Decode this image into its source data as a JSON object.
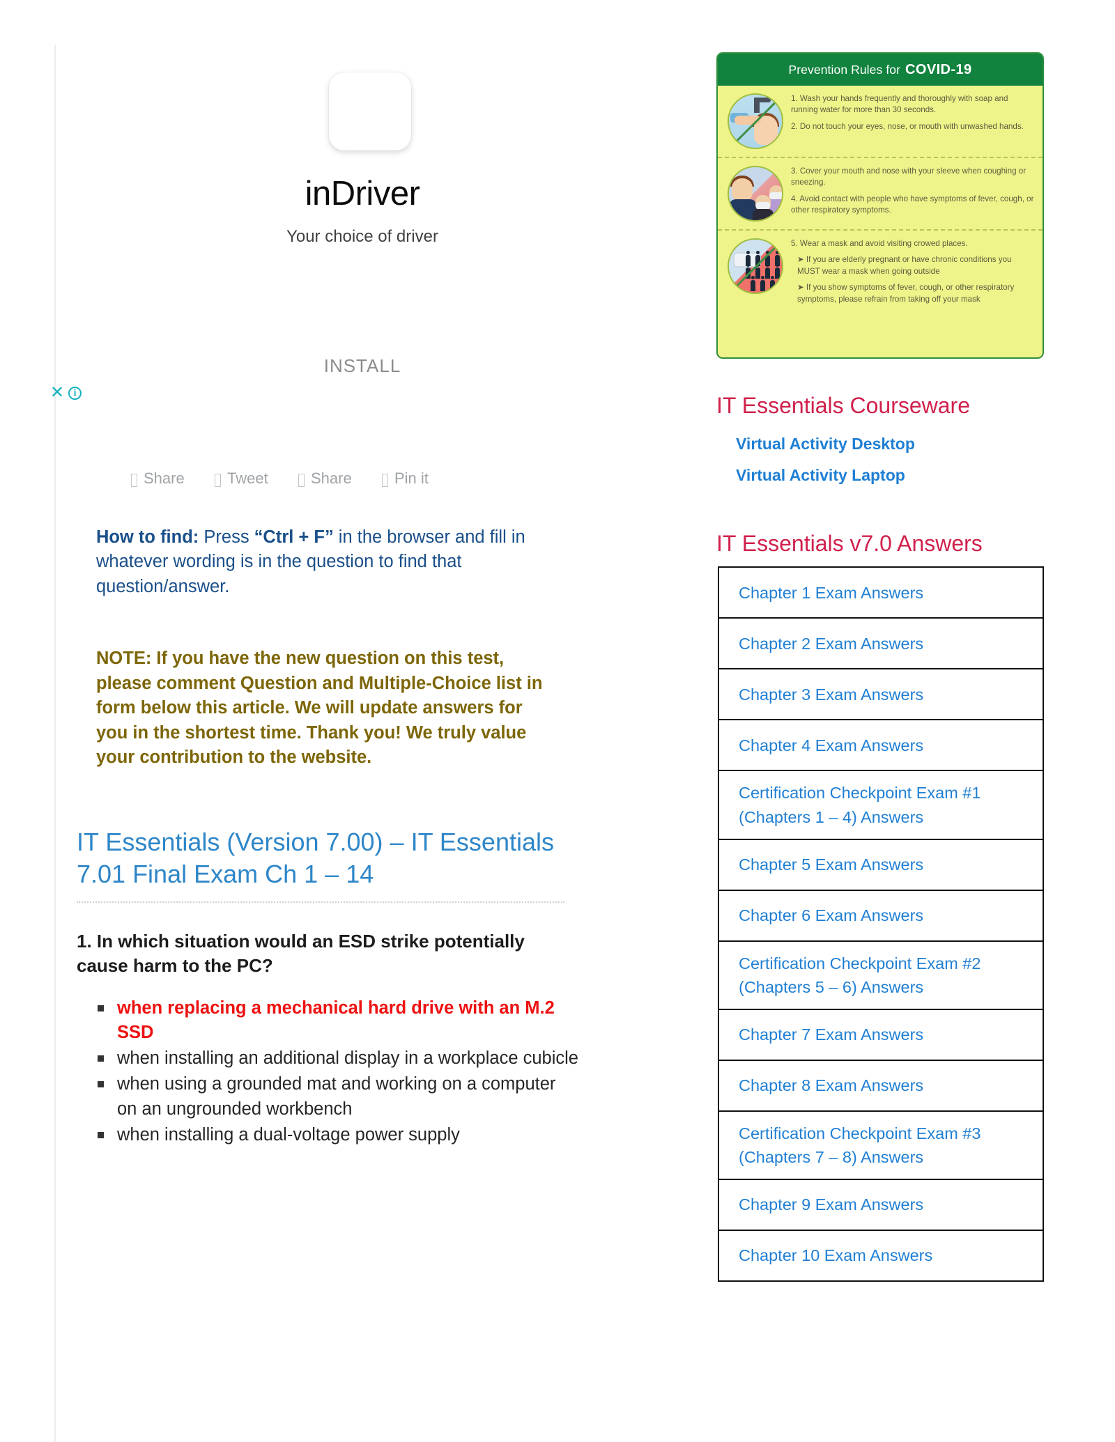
{
  "ad": {
    "app_name": "inDriver",
    "tagline": "Your choice of driver",
    "cta": "INSTALL",
    "close_icon": "✕",
    "info_icon": "i"
  },
  "share_bar": [
    {
      "label": "Share",
      "icon": "facebook-icon"
    },
    {
      "label": "Tweet",
      "icon": "twitter-icon"
    },
    {
      "label": "Share",
      "icon": "linkedin-icon"
    },
    {
      "label": "Pin it",
      "icon": "pinterest-icon"
    }
  ],
  "article": {
    "howto_lead": "How to find:",
    "howto_mid": " Press ",
    "howto_key": "“Ctrl + F”",
    "howto_rest": " in the browser and fill in whatever wording is in the question to find that question/answer.",
    "note": "NOTE: If you have the new question on this test, please comment Question and Multiple-Choice list in form below this article. We will update answers for you in the shortest time. Thank you! We truly value your contribution to the website.",
    "title": "IT Essentials (Version 7.00) – IT Essentials 7.01 Final Exam Ch 1 – 14",
    "question": "1. In which situation would an ESD strike potentially cause harm to the PC?",
    "choices": [
      {
        "text": "when replacing a mechanical hard drive with an M.2 SSD",
        "correct": true
      },
      {
        "text": "when installing an additional display in a workplace cubicle",
        "correct": false
      },
      {
        "text": "when using a grounded mat and working on a computer on an ungrounded workbench",
        "correct": false
      },
      {
        "text": "when installing a dual-voltage power supply",
        "correct": false
      }
    ]
  },
  "covid": {
    "header_prefix": "Prevention Rules for",
    "header_bold": "COVID-19",
    "rows": [
      {
        "items": [
          "1. Wash your hands frequently and thoroughly with soap and running water for more than 30 seconds.",
          "2. Do not touch your eyes, nose, or mouth with unwashed hands."
        ]
      },
      {
        "items": [
          "3. Cover your mouth and nose with your sleeve when coughing or sneezing.",
          "4. Avoid contact with people who have symptoms of fever, cough, or other respiratory symptoms."
        ]
      },
      {
        "items": [
          "5. Wear a mask and avoid visiting crowed places.",
          "➤ If you are elderly pregnant or have chronic conditions you MUST wear a mask when going outside",
          "➤ If you show symptoms of fever, cough, or other respiratory symptoms, please refrain from taking off your mask"
        ]
      }
    ]
  },
  "sidebar": {
    "courseware_title": "IT Essentials Courseware",
    "courseware_links": [
      "Virtual Activity Desktop",
      "Virtual Activity Laptop"
    ],
    "answers_title": "IT Essentials v7.0 Answers",
    "answers_links": [
      "Chapter 1 Exam Answers",
      "Chapter 2 Exam Answers",
      "Chapter 3 Exam Answers",
      "Chapter 4 Exam Answers",
      "Certification Checkpoint Exam #1 (Chapters 1 – 4) Answers",
      "Chapter 5 Exam Answers",
      "Chapter 6 Exam Answers",
      "Certification Checkpoint Exam #2 (Chapters 5 – 6) Answers",
      "Chapter 7 Exam Answers",
      "Chapter 8 Exam Answers",
      "Certification Checkpoint Exam #3 (Chapters 7 – 8) Answers",
      "Chapter 9 Exam Answers",
      "Chapter 10 Exam Answers"
    ]
  },
  "colors": {
    "link_blue": "#1f7fd4",
    "heading_crimson": "#d0214c",
    "title_blue": "#2e86c8",
    "note_olive": "#7d6608",
    "correct_red": "#ee1111",
    "ad_teal": "#18b2c0",
    "covid_green": "#12833f"
  }
}
